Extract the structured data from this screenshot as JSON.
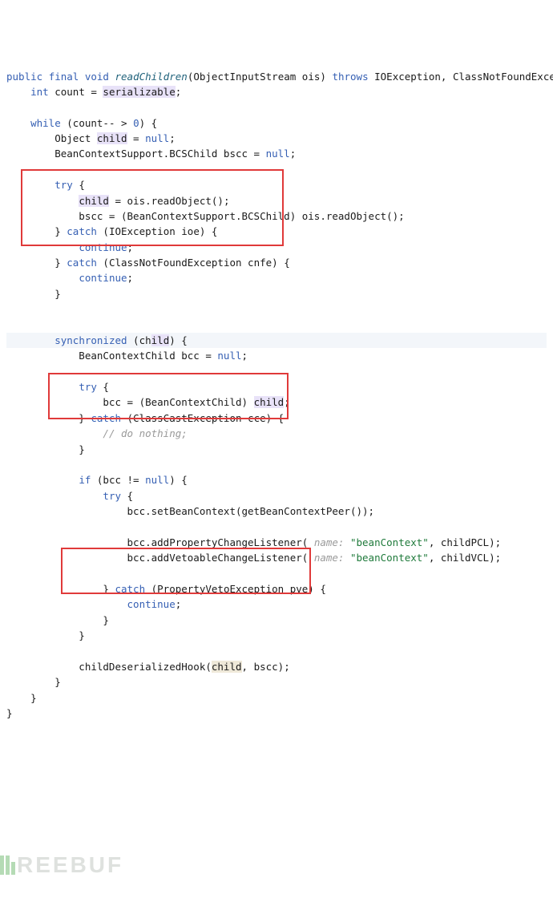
{
  "code": {
    "l1a": "public",
    "l1b": "final",
    "l1c": "void",
    "l1d": "readChildren",
    "l1e": "(ObjectInputStream ois) ",
    "l1f": "throws",
    "l1g": " IOException, ClassNotFoundException {",
    "l2a": "    ",
    "l2b": "int",
    "l2c": " count = ",
    "l2d": "serializable",
    "l2e": ";",
    "l3": "",
    "l4a": "    ",
    "l4b": "while",
    "l4c": " (count-- > ",
    "l4d": "0",
    "l4e": ") {",
    "l5a": "        Object ",
    "l5b": "child",
    "l5c": " = ",
    "l5d": "null",
    "l5e": ";",
    "l6a": "        BeanContextSupport.BCSChild bscc = ",
    "l6b": "null",
    "l6c": ";",
    "l7": "",
    "l8a": "        ",
    "l8b": "try",
    "l8c": " {",
    "l9a": "            ",
    "l9b": "child",
    "l9c": " = ois.readObject();",
    "l10a": "            bscc = (BeanContextSupport.BCSChild) ois.readObject();",
    "l11a": "        } ",
    "l11b": "catch",
    "l11c": " (IOException ioe) {",
    "l12a": "            ",
    "l12b": "continue",
    "l12c": ";",
    "l13a": "        } ",
    "l13b": "catch",
    "l13c": " (ClassNotFoundException cnfe) {",
    "l14a": "            ",
    "l14b": "continue",
    "l14c": ";",
    "l15": "        }",
    "l16": "",
    "l17": "",
    "l18a": "        ",
    "l18b": "synchronized",
    "l18c": " (ch",
    "l18d": "ild",
    "l18e": ") {",
    "l19a": "            BeanContextChild bcc = ",
    "l19b": "null",
    "l19c": ";",
    "l20": "",
    "l21a": "            ",
    "l21b": "try",
    "l21c": " {",
    "l22a": "                bcc = (BeanContextChild) ",
    "l22b": "child",
    "l22c": ";",
    "l23a": "            } ",
    "l23b": "catch",
    "l23c": " (ClassCastException cce) {",
    "l24a": "                ",
    "l24b": "// do nothing;",
    "l25": "            }",
    "l26": "",
    "l27a": "            ",
    "l27b": "if",
    "l27c": " (bcc != ",
    "l27d": "null",
    "l27e": ") {",
    "l28a": "                ",
    "l28b": "try",
    "l28c": " {",
    "l29a": "                    bcc.setBeanContext(getBeanContextPeer());",
    "l30": "",
    "l31a": "                    bcc.addPropertyChangeListener( ",
    "l31b": "name:",
    "l31c": " ",
    "l31d": "\"beanContext\"",
    "l31e": ", childPCL);",
    "l32a": "                    bcc.addVetoableChangeListener( ",
    "l32b": "name:",
    "l32c": " ",
    "l32d": "\"beanContext\"",
    "l32e": ", childVCL);",
    "l33": "",
    "l34a": "                } ",
    "l34b": "catch",
    "l34c": " (PropertyVetoException pve) {",
    "l35a": "                    ",
    "l35b": "continue",
    "l35c": ";",
    "l36": "                }",
    "l37": "            }",
    "l38": "",
    "l39a": "            childDeserializedHook(",
    "l39b": "child",
    "l39c": ", bscc);",
    "l40": "        }",
    "l41": "    }",
    "l42": "}"
  },
  "watermark": "REEBUF"
}
